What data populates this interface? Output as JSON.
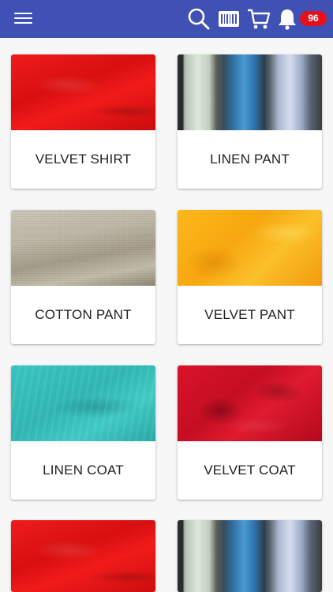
{
  "header": {
    "menu_icon": "hamburger-menu-icon",
    "icons": [
      "search-icon",
      "barcode-icon",
      "cart-icon",
      "bell-icon"
    ],
    "notification_count": "96",
    "colors": {
      "bar": "#3f51b5",
      "badge": "#e4111d"
    }
  },
  "products": [
    {
      "label": "VELVET SHIRT",
      "image": "red-velvet-fabric"
    },
    {
      "label": "LINEN PANT",
      "image": "thread-spools"
    },
    {
      "label": "COTTON PANT",
      "image": "beige-linen-fabric"
    },
    {
      "label": "VELVET PANT",
      "image": "yellow-fabric"
    },
    {
      "label": "LINEN COAT",
      "image": "teal-crinkled-fabric"
    },
    {
      "label": "VELVET COAT",
      "image": "crimson-draped-fabric"
    },
    {
      "label": "",
      "image": "red-velvet-fabric"
    },
    {
      "label": "",
      "image": "thread-spools"
    }
  ]
}
